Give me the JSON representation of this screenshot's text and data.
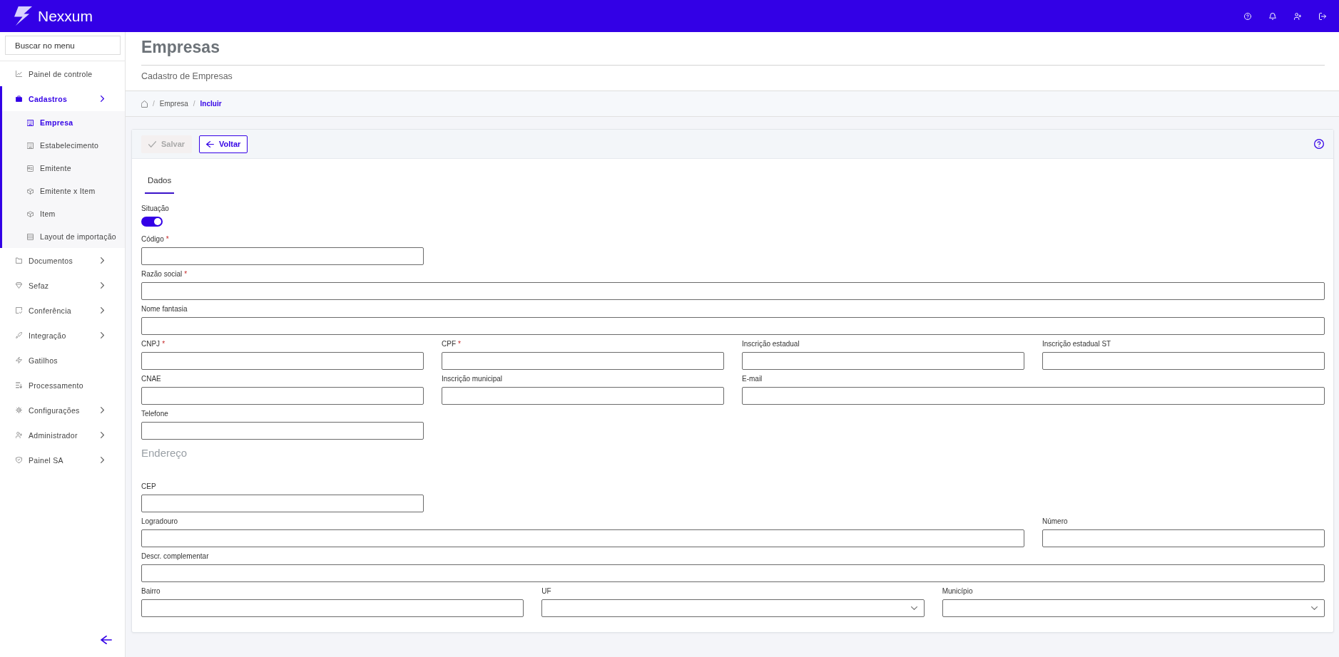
{
  "top_bar": {
    "brand": "Nexxum"
  },
  "sidebar": {
    "search": {
      "placeholder": "Buscar no menu"
    },
    "items": [
      {
        "label": "Painel de controle",
        "selected": false,
        "expandable": false
      },
      {
        "label": "Cadastros",
        "selected": true,
        "expandable": true,
        "children": [
          {
            "label": "Empresa",
            "selected": true
          },
          {
            "label": "Estabelecimento",
            "selected": false
          },
          {
            "label": "Emitente",
            "selected": false
          },
          {
            "label": "Emitente x Item",
            "selected": false
          },
          {
            "label": "Item",
            "selected": false
          },
          {
            "label": "Layout de importação",
            "selected": false
          }
        ]
      },
      {
        "label": "Documentos",
        "selected": false,
        "expandable": true
      },
      {
        "label": "Sefaz",
        "selected": false,
        "expandable": true
      },
      {
        "label": "Conferência",
        "selected": false,
        "expandable": true
      },
      {
        "label": "Integração",
        "selected": false,
        "expandable": true
      },
      {
        "label": "Gatilhos",
        "selected": false,
        "expandable": false
      },
      {
        "label": "Processamento",
        "selected": false,
        "expandable": false
      },
      {
        "label": "Configurações",
        "selected": false,
        "expandable": true
      },
      {
        "label": "Administrador",
        "selected": false,
        "expandable": true
      },
      {
        "label": "Painel SA",
        "selected": false,
        "expandable": true
      }
    ]
  },
  "page_header": {
    "title": "Empresas",
    "subtitle": "Cadastro de Empresas"
  },
  "breadcrumb": {
    "separator": "/",
    "items": [
      {
        "label": "Empresa",
        "selected": false
      },
      {
        "label": "Incluir",
        "selected": true
      }
    ]
  },
  "toolbar": {
    "buttons": [
      {
        "label": "Salvar",
        "kind": "save",
        "disabled": true
      },
      {
        "label": "Voltar",
        "kind": "back",
        "disabled": false
      }
    ]
  },
  "tabs": [
    {
      "label": "Dados",
      "selected": true
    }
  ],
  "form": {
    "toggle": {
      "label": "Situação",
      "on": true
    },
    "sections": [
      {
        "rows": [
          [
            {
              "label": "Código",
              "required_mark": "*",
              "kind": "text"
            }
          ],
          [
            {
              "label": "Razão social",
              "required_mark": "*",
              "kind": "text"
            }
          ],
          [
            {
              "label": "Nome fantasia",
              "kind": "text"
            }
          ],
          [
            {
              "label": "CNPJ",
              "required_mark": "*",
              "kind": "text"
            },
            {
              "label": "CPF",
              "required_mark": "*",
              "kind": "text"
            },
            {
              "label": "Inscrição estadual",
              "kind": "text"
            },
            {
              "label": "Inscrição estadual ST",
              "kind": "text"
            }
          ],
          [
            {
              "label": "CNAE",
              "kind": "text"
            },
            {
              "label": "Inscrição municipal",
              "kind": "text"
            },
            {
              "label": "E-mail",
              "kind": "text"
            }
          ],
          [
            {
              "label": "Telefone",
              "kind": "text"
            }
          ]
        ]
      },
      {
        "title": "Endereço",
        "rows": [
          [
            {
              "label": "CEP",
              "kind": "text"
            }
          ],
          [
            {
              "label": "Logradouro",
              "kind": "text"
            },
            {
              "label": "Número",
              "kind": "text"
            }
          ],
          [
            {
              "label": "Descr. complementar",
              "kind": "text"
            }
          ],
          [
            {
              "label": "Bairro",
              "kind": "text"
            },
            {
              "label": "UF",
              "kind": "select"
            },
            {
              "label": "Município",
              "kind": "select"
            }
          ]
        ]
      }
    ]
  }
}
